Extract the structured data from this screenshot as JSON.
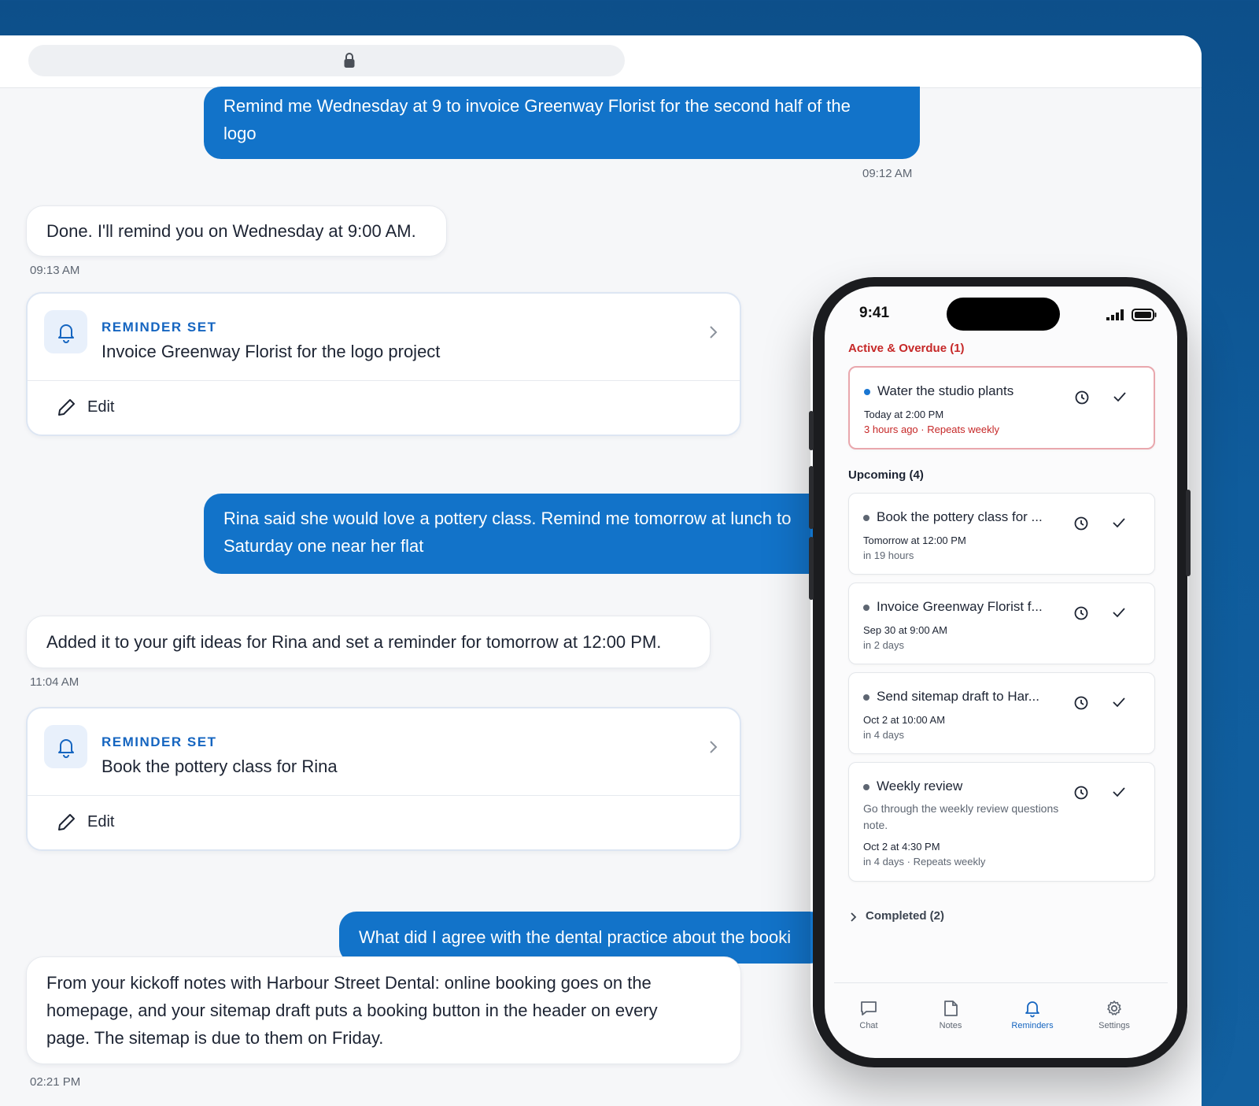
{
  "chat": {
    "messages": [
      {
        "role": "user",
        "text_line1": "Remind me Wednesday at 9 to invoice Greenway Florist for the second half of the",
        "text_line2": "logo",
        "time": "09:12 AM"
      },
      {
        "role": "assistant",
        "text": "Done. I'll remind you on Wednesday at 9:00 AM.",
        "time": "09:13 AM"
      },
      {
        "role": "card",
        "label": "REMINDER SET",
        "title": "Invoice Greenway Florist for the logo project",
        "edit_label": "Edit"
      },
      {
        "role": "user",
        "text_line1": "Rina said she would love a pottery class. Remind me tomorrow at lunch to",
        "text_line2": "Saturday one near her flat"
      },
      {
        "role": "assistant",
        "text": "Added it to your gift ideas for Rina and set a reminder for tomorrow at 12:00 PM.",
        "time": "11:04 AM"
      },
      {
        "role": "card",
        "label": "REMINDER SET",
        "title": "Book the pottery class for Rina",
        "edit_label": "Edit"
      },
      {
        "role": "user",
        "text_line1": "What did I agree with the dental practice about the booki"
      },
      {
        "role": "assistant",
        "text_line1": "From your kickoff notes with Harbour Street Dental: online booking goes on the",
        "text_line2": "homepage, and your sitemap draft puts a booking button in the header on every",
        "text_line3": "page. The sitemap is due to them on Friday.",
        "time": "02:21 PM"
      }
    ]
  },
  "phone": {
    "status_time": "9:41",
    "overdue": {
      "title": "Active & Overdue (1)",
      "items": [
        {
          "title": "Water the studio plants",
          "date": "Today at 2:00 PM",
          "relative": "3 hours ago · Repeats weekly"
        }
      ]
    },
    "upcoming": {
      "title": "Upcoming (4)",
      "items": [
        {
          "title": "Book the pottery class for ...",
          "date": "Tomorrow at 12:00 PM",
          "relative": "in 19 hours"
        },
        {
          "title": "Invoice Greenway Florist f...",
          "date": "Sep 30 at 9:00 AM",
          "relative": "in 2 days"
        },
        {
          "title": "Send sitemap draft to Har...",
          "date": "Oct 2 at 10:00 AM",
          "relative": "in 4 days"
        },
        {
          "title": "Weekly review",
          "description": "Go through the weekly review questions note.",
          "date": "Oct 2 at 4:30 PM",
          "relative": "in 4 days · Repeats weekly"
        }
      ]
    },
    "completed_label": "Completed (2)",
    "tabs": [
      {
        "label": "Chat",
        "icon": "chat-icon"
      },
      {
        "label": "Notes",
        "icon": "notes-icon"
      },
      {
        "label": "Reminders",
        "icon": "bell-icon",
        "active": true
      },
      {
        "label": "Settings",
        "icon": "gear-icon"
      }
    ]
  },
  "colors": {
    "accent": "#1273c9",
    "overdue_red": "#c62828",
    "reminder_label": "#1565c0"
  }
}
